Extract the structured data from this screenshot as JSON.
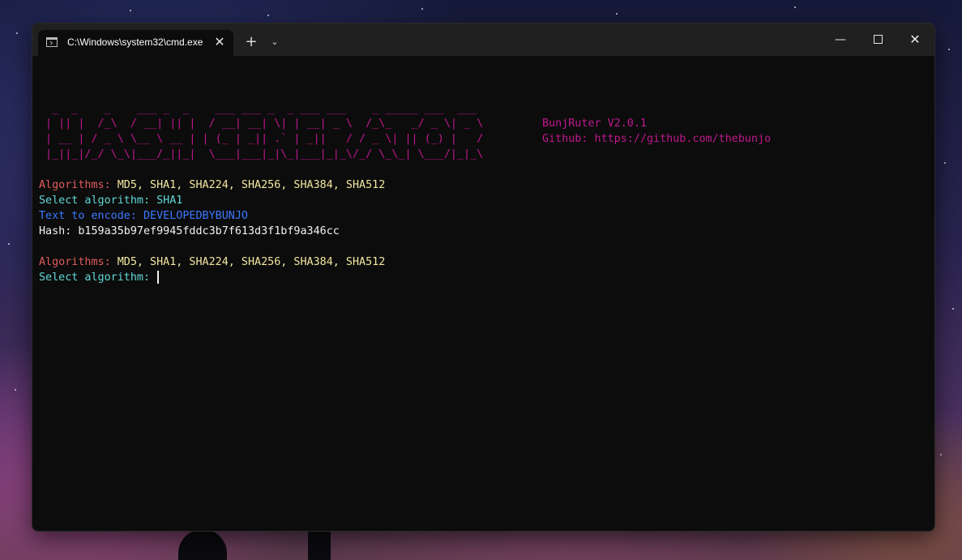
{
  "window": {
    "tab_title": "C:\\Windows\\system32\\cmd.exe",
    "tab_close": "✕",
    "new_tab": "+",
    "dropdown": "⌄",
    "minimize": "—",
    "close": "✕"
  },
  "terminal": {
    "banner": [
      "  _  _    _    ___ _  _    ___ ___ _  _ ___ ___    _ _____ ___  ___ ",
      " | || |  /_\\  / __| || |  / __| __| \\| | __| _ \\  /_\\_   _/ _ \\| _ \\",
      " | __ | / _ \\ \\__ \\ __ | | (_ | _|| .` | _||   / / _ \\| || (_) |   /",
      " |_||_|/_/ \\_\\|___/_||_|  \\___|___|_|\\_|___|_|_\\/_/ \\_\\_| \\___/|_|_\\"
    ],
    "version": "BunjRuter V2.0.1",
    "github": "Github: https://github.com/thebunjo",
    "session1": {
      "algorithms_label": "Algorithms: ",
      "algorithms_list": "MD5, SHA1, SHA224, SHA256, SHA384, SHA512",
      "select_prompt": "Select algorithm: SHA1",
      "encode_label": "Text to encode: ",
      "encode_value": "DEVELOPEDBYBUNJO",
      "hash_line": "Hash: b159a35b97ef9945fddc3b7f613d3f1bf9a346cc"
    },
    "session2": {
      "algorithms_label": "Algorithms: ",
      "algorithms_list": "MD5, SHA1, SHA224, SHA256, SHA384, SHA512",
      "select_prompt": "Select algorithm: "
    }
  },
  "colors": {
    "banner": "#c0188e",
    "algorithms_label": "#e25b5b",
    "algorithms_list": "#f2e6a0",
    "prompt": "#61d6d6",
    "encode": "#3b78ff",
    "hash": "#f2f2f2"
  }
}
